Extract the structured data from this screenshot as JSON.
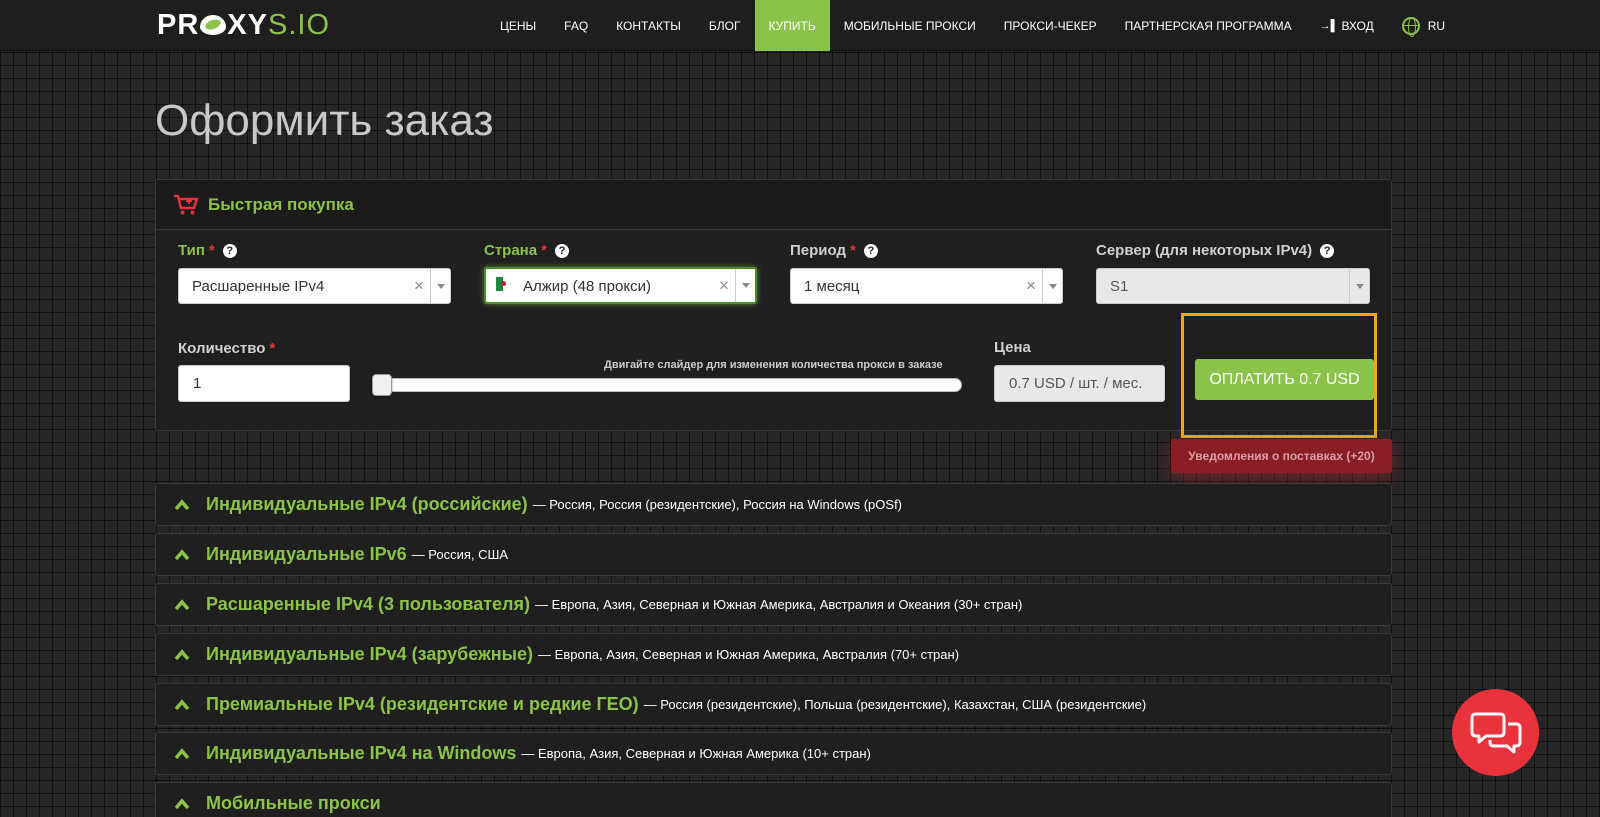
{
  "header": {
    "logo": {
      "part1": "PR",
      "part2": "XY",
      "part3": "S.IO"
    },
    "nav": [
      {
        "label": "ЦЕНЫ"
      },
      {
        "label": "FAQ"
      },
      {
        "label": "КОНТАКТЫ"
      },
      {
        "label": "БЛОГ"
      },
      {
        "label": "КУПИТЬ",
        "active": true
      },
      {
        "label": "МОБИЛЬНЫЕ ПРОКСИ"
      },
      {
        "label": "ПРОКСИ-ЧЕКЕР"
      },
      {
        "label": "ПАРТНЕРСКАЯ ПРОГРАММА"
      },
      {
        "label": "ВХОД",
        "icon": "login-icon"
      },
      {
        "label": "RU",
        "icon": "globe-icon"
      }
    ]
  },
  "page_title": "Оформить заказ",
  "quick_buy": {
    "title": "Быстрая покупка",
    "type": {
      "label": "Тип",
      "required": "*",
      "help": "?",
      "value": "Расшаренные IPv4",
      "clear": "×"
    },
    "country": {
      "label": "Страна",
      "required": "*",
      "help": "?",
      "value": "Алжир (48 прокси)",
      "clear": "×",
      "flag": "algeria-flag-icon"
    },
    "period": {
      "label": "Период",
      "required": "*",
      "help": "?",
      "value": "1 месяц",
      "clear": "×"
    },
    "server": {
      "label": "Сервер (для некоторых IPv4)",
      "help": "?",
      "value": "S1"
    },
    "quantity": {
      "label": "Количество",
      "required": "*",
      "value": "1"
    },
    "slider": {
      "hint": "Двигайте слайдер для изменения количества прокси в заказе",
      "value": 1
    },
    "price": {
      "label": "Цена",
      "value": "0.7 USD / шт. / мес."
    },
    "pay_button": "ОПЛАТИТЬ 0.7 USD",
    "notify_button": "Уведомления о поставках (+20)"
  },
  "categories": [
    {
      "title": "Индивидуальные IPv4 (российские)",
      "desc": "— Россия, Россия (резидентские), Россия на Windows (pOSf)"
    },
    {
      "title": "Индивидуальные IPv6",
      "desc": "— Россия, США"
    },
    {
      "title": "Расшаренные IPv4 (3 пользователя)",
      "desc": "— Европа, Азия, Северная и Южная Америка, Австралия и Океания (30+ стран)"
    },
    {
      "title": "Индивидуальные IPv4 (зарубежные)",
      "desc": "— Европа, Азия, Северная и Южная Америка, Австралия (70+ стран)"
    },
    {
      "title": "Премиальные IPv4 (резидентские и редкие ГЕО)",
      "desc": "— Россия (резидентские), Польша (резидентские), Казахстан, США (резидентские)"
    },
    {
      "title": "Индивидуальные IPv4 на Windows",
      "desc": "— Европа, Азия, Северная и Южная Америка (10+ стран)"
    },
    {
      "title": "Мобильные прокси",
      "desc": ""
    }
  ],
  "colors": {
    "accent": "#8bc34a",
    "highlight_frame": "#f0a81a",
    "chat": "#e8323c",
    "notify": "#8a1e27"
  }
}
